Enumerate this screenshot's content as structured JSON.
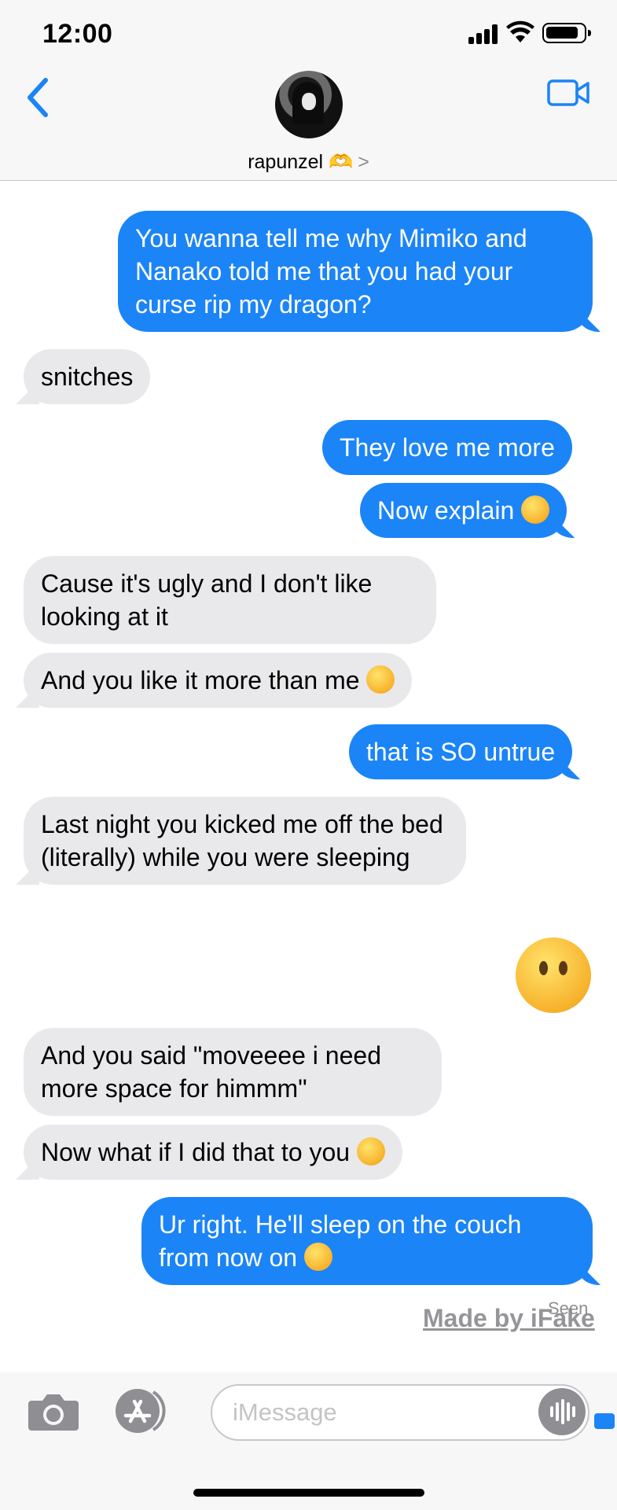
{
  "status_bar": {
    "time": "12:00"
  },
  "header": {
    "contact_name": "rapunzel 🫶",
    "chevron": ">"
  },
  "messages": [
    {
      "from": "me",
      "text": "You wanna tell me why Mimiko and Nanako told me that you had your curse rip my dragon?"
    },
    {
      "from": "them",
      "text": "snitches"
    },
    {
      "from": "me",
      "text": "They love me more"
    },
    {
      "from": "me",
      "text": "Now explain",
      "emoji": "raised-eyebrow"
    },
    {
      "from": "them",
      "text": "Cause it's ugly and I don't like looking at it"
    },
    {
      "from": "them",
      "text": "And you like it more than me",
      "emoji": "expressionless"
    },
    {
      "from": "me",
      "text": "that is SO untrue"
    },
    {
      "from": "them",
      "text": "Last night you kicked me off the bed (literally) while you were sleeping"
    },
    {
      "from": "me",
      "emoji_only": "face-without-mouth"
    },
    {
      "from": "them",
      "text": "And you said \"moveeee i need more space for himmm\""
    },
    {
      "from": "them",
      "text": "Now what if I did that to you",
      "emoji": "unamused"
    },
    {
      "from": "me",
      "text": "Ur right. He'll sleep on the couch from now on",
      "emoji": "pensive"
    }
  ],
  "seen_label": "Seen",
  "watermark": "Made by iFake",
  "input": {
    "placeholder": "iMessage",
    "value": ""
  },
  "colors": {
    "sent": "#1b84f7",
    "received": "#e9e9eb",
    "accent": "#1b84f7"
  }
}
